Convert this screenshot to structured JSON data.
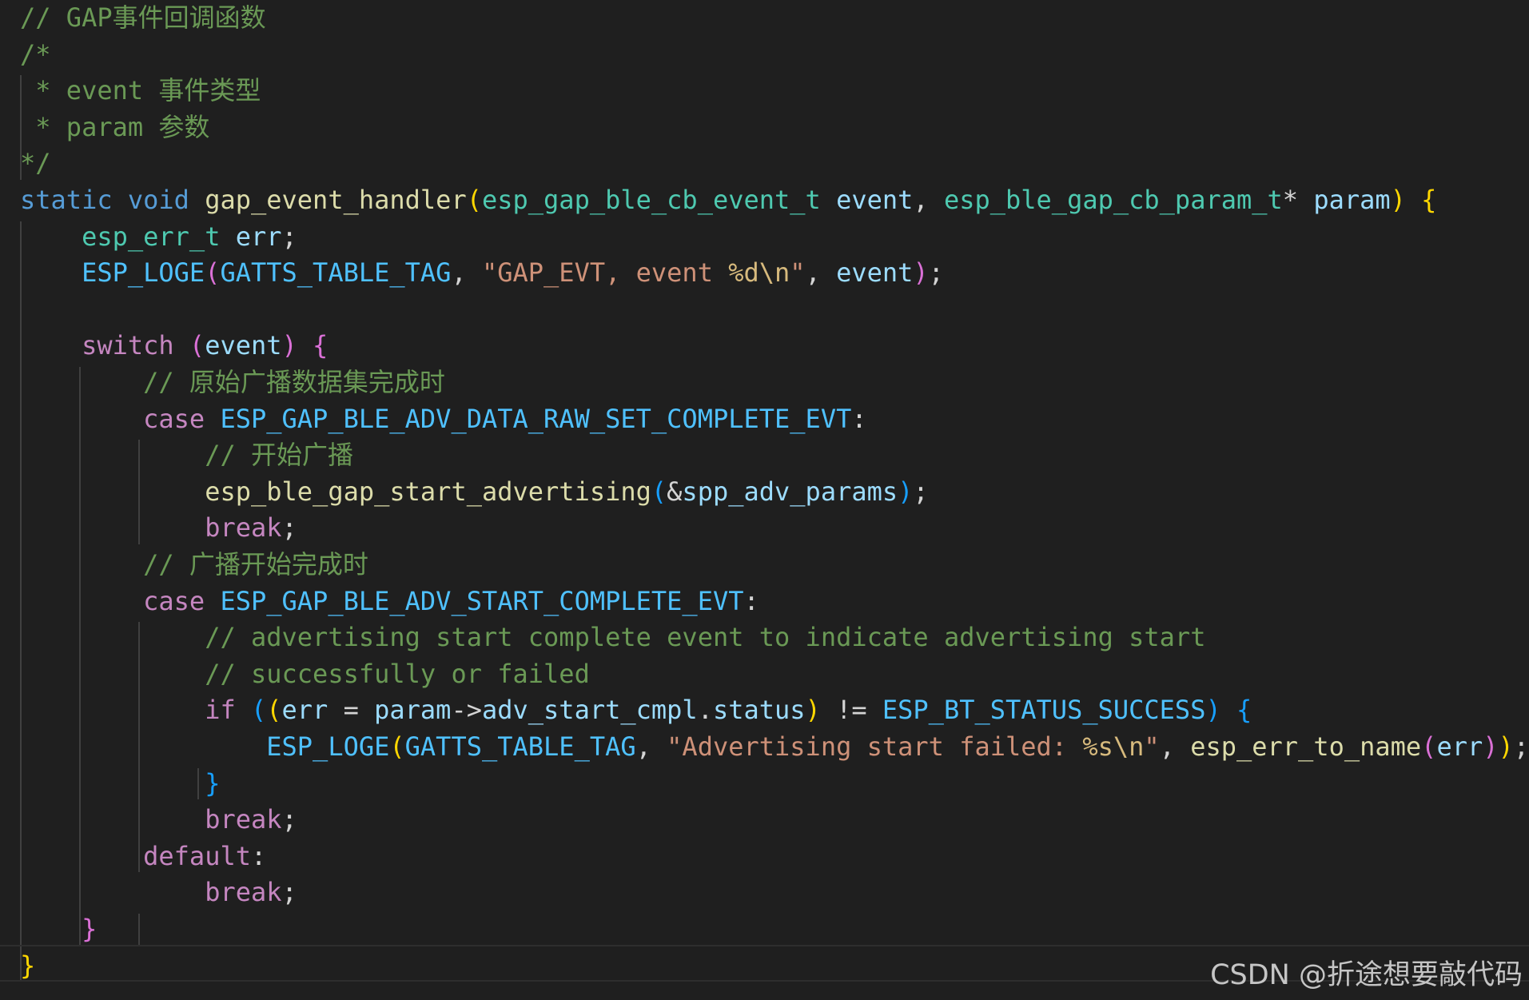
{
  "editor": {
    "theme": {
      "background": "#1f1f1f",
      "comment": "#6a9955",
      "keyword": "#569cd6",
      "control": "#c586c0",
      "function": "#dcdcaa",
      "type": "#4ec9b0",
      "variable": "#9cdcfe",
      "constant": "#4fc1ff",
      "string": "#ce9178",
      "escape": "#d7ba7d",
      "plain": "#d4d4d4",
      "bracket1": "#ffd700",
      "bracket2": "#da70d6",
      "bracket3": "#179fff"
    },
    "lines": [
      [
        {
          "t": "// GAP事件回调函数",
          "c": "comment"
        }
      ],
      [
        {
          "t": "/*",
          "c": "comment"
        }
      ],
      [
        {
          "t": " * event 事件类型",
          "c": "comment"
        }
      ],
      [
        {
          "t": " * param 参数",
          "c": "comment"
        }
      ],
      [
        {
          "t": "*/",
          "c": "comment"
        }
      ],
      [
        {
          "t": "static",
          "c": "keyword"
        },
        {
          "t": " ",
          "c": "plain"
        },
        {
          "t": "void",
          "c": "keyword"
        },
        {
          "t": " ",
          "c": "plain"
        },
        {
          "t": "gap_event_handler",
          "c": "function"
        },
        {
          "t": "(",
          "c": "bracket1"
        },
        {
          "t": "esp_gap_ble_cb_event_t",
          "c": "type"
        },
        {
          "t": " ",
          "c": "plain"
        },
        {
          "t": "event",
          "c": "variable"
        },
        {
          "t": ", ",
          "c": "plain"
        },
        {
          "t": "esp_ble_gap_cb_param_t",
          "c": "type"
        },
        {
          "t": "* ",
          "c": "plain"
        },
        {
          "t": "param",
          "c": "variable"
        },
        {
          "t": ")",
          "c": "bracket1"
        },
        {
          "t": " ",
          "c": "plain"
        },
        {
          "t": "{",
          "c": "bracket1"
        }
      ],
      [
        {
          "t": "    ",
          "c": "plain"
        },
        {
          "t": "esp_err_t",
          "c": "type"
        },
        {
          "t": " ",
          "c": "plain"
        },
        {
          "t": "err",
          "c": "variable"
        },
        {
          "t": ";",
          "c": "plain"
        }
      ],
      [
        {
          "t": "    ",
          "c": "plain"
        },
        {
          "t": "ESP_LOGE",
          "c": "constant"
        },
        {
          "t": "(",
          "c": "bracket2"
        },
        {
          "t": "GATTS_TABLE_TAG",
          "c": "constant"
        },
        {
          "t": ", ",
          "c": "plain"
        },
        {
          "t": "\"GAP_EVT, event ",
          "c": "string"
        },
        {
          "t": "%d\\n",
          "c": "escape"
        },
        {
          "t": "\"",
          "c": "string"
        },
        {
          "t": ", ",
          "c": "plain"
        },
        {
          "t": "event",
          "c": "variable"
        },
        {
          "t": ")",
          "c": "bracket2"
        },
        {
          "t": ";",
          "c": "plain"
        }
      ],
      [],
      [
        {
          "t": "    ",
          "c": "plain"
        },
        {
          "t": "switch",
          "c": "control"
        },
        {
          "t": " ",
          "c": "plain"
        },
        {
          "t": "(",
          "c": "bracket2"
        },
        {
          "t": "event",
          "c": "variable"
        },
        {
          "t": ")",
          "c": "bracket2"
        },
        {
          "t": " ",
          "c": "plain"
        },
        {
          "t": "{",
          "c": "bracket2"
        }
      ],
      [
        {
          "t": "        ",
          "c": "plain"
        },
        {
          "t": "// 原始广播数据集完成时",
          "c": "comment"
        }
      ],
      [
        {
          "t": "        ",
          "c": "plain"
        },
        {
          "t": "case",
          "c": "control"
        },
        {
          "t": " ",
          "c": "plain"
        },
        {
          "t": "ESP_GAP_BLE_ADV_DATA_RAW_SET_COMPLETE_EVT",
          "c": "constant"
        },
        {
          "t": ":",
          "c": "plain"
        }
      ],
      [
        {
          "t": "            ",
          "c": "plain"
        },
        {
          "t": "// 开始广播",
          "c": "comment"
        }
      ],
      [
        {
          "t": "            ",
          "c": "plain"
        },
        {
          "t": "esp_ble_gap_start_advertising",
          "c": "function"
        },
        {
          "t": "(",
          "c": "bracket3"
        },
        {
          "t": "&",
          "c": "plain"
        },
        {
          "t": "spp_adv_params",
          "c": "variable"
        },
        {
          "t": ")",
          "c": "bracket3"
        },
        {
          "t": ";",
          "c": "plain"
        }
      ],
      [
        {
          "t": "            ",
          "c": "plain"
        },
        {
          "t": "break",
          "c": "control"
        },
        {
          "t": ";",
          "c": "plain"
        }
      ],
      [
        {
          "t": "        ",
          "c": "plain"
        },
        {
          "t": "// 广播开始完成时",
          "c": "comment"
        }
      ],
      [
        {
          "t": "        ",
          "c": "plain"
        },
        {
          "t": "case",
          "c": "control"
        },
        {
          "t": " ",
          "c": "plain"
        },
        {
          "t": "ESP_GAP_BLE_ADV_START_COMPLETE_EVT",
          "c": "constant"
        },
        {
          "t": ":",
          "c": "plain"
        }
      ],
      [
        {
          "t": "            ",
          "c": "plain"
        },
        {
          "t": "// advertising start complete event to indicate advertising start",
          "c": "comment"
        }
      ],
      [
        {
          "t": "            ",
          "c": "plain"
        },
        {
          "t": "// successfully or failed",
          "c": "comment"
        }
      ],
      [
        {
          "t": "            ",
          "c": "plain"
        },
        {
          "t": "if",
          "c": "control"
        },
        {
          "t": " ",
          "c": "plain"
        },
        {
          "t": "(",
          "c": "bracket3"
        },
        {
          "t": "(",
          "c": "bracket1"
        },
        {
          "t": "err",
          "c": "variable"
        },
        {
          "t": " = ",
          "c": "plain"
        },
        {
          "t": "param",
          "c": "variable"
        },
        {
          "t": "->",
          "c": "plain"
        },
        {
          "t": "adv_start_cmpl",
          "c": "variable"
        },
        {
          "t": ".",
          "c": "plain"
        },
        {
          "t": "status",
          "c": "variable"
        },
        {
          "t": ")",
          "c": "bracket1"
        },
        {
          "t": " != ",
          "c": "plain"
        },
        {
          "t": "ESP_BT_STATUS_SUCCESS",
          "c": "constant"
        },
        {
          "t": ")",
          "c": "bracket3"
        },
        {
          "t": " ",
          "c": "plain"
        },
        {
          "t": "{",
          "c": "bracket3"
        }
      ],
      [
        {
          "t": "                ",
          "c": "plain"
        },
        {
          "t": "ESP_LOGE",
          "c": "constant"
        },
        {
          "t": "(",
          "c": "bracket1"
        },
        {
          "t": "GATTS_TABLE_TAG",
          "c": "constant"
        },
        {
          "t": ", ",
          "c": "plain"
        },
        {
          "t": "\"Advertising start failed: ",
          "c": "string"
        },
        {
          "t": "%s\\n",
          "c": "escape"
        },
        {
          "t": "\"",
          "c": "string"
        },
        {
          "t": ", ",
          "c": "plain"
        },
        {
          "t": "esp_err_to_name",
          "c": "function"
        },
        {
          "t": "(",
          "c": "bracket2"
        },
        {
          "t": "err",
          "c": "variable"
        },
        {
          "t": ")",
          "c": "bracket2"
        },
        {
          "t": ")",
          "c": "bracket1"
        },
        {
          "t": ";",
          "c": "plain"
        }
      ],
      [
        {
          "t": "            ",
          "c": "plain"
        },
        {
          "t": "}",
          "c": "bracket3"
        }
      ],
      [
        {
          "t": "            ",
          "c": "plain"
        },
        {
          "t": "break",
          "c": "control"
        },
        {
          "t": ";",
          "c": "plain"
        }
      ],
      [
        {
          "t": "        ",
          "c": "plain"
        },
        {
          "t": "default",
          "c": "control"
        },
        {
          "t": ":",
          "c": "plain"
        }
      ],
      [
        {
          "t": "            ",
          "c": "plain"
        },
        {
          "t": "break",
          "c": "control"
        },
        {
          "t": ";",
          "c": "plain"
        }
      ],
      [
        {
          "t": "    ",
          "c": "plain"
        },
        {
          "t": "}",
          "c": "bracket2"
        }
      ],
      [
        {
          "t": "}",
          "c": "bracket1"
        }
      ]
    ]
  },
  "watermark": {
    "text": "CSDN @折途想要敲代码"
  }
}
